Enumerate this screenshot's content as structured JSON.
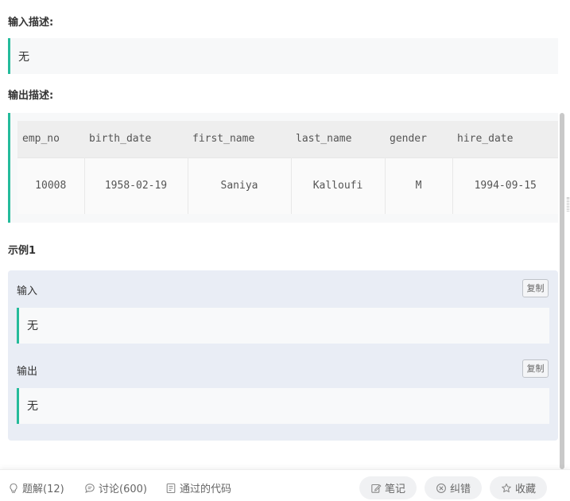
{
  "input_desc": {
    "label": "输入描述:",
    "value": "无"
  },
  "output_desc": {
    "label": "输出描述:",
    "table": {
      "headers": [
        "emp_no",
        "birth_date",
        "first_name",
        "last_name",
        "gender",
        "hire_date"
      ],
      "rows": [
        [
          "10008",
          "1958-02-19",
          "Saniya",
          "Kalloufi",
          "M",
          "1994-09-15"
        ]
      ]
    }
  },
  "example": {
    "title": "示例1",
    "input": {
      "label": "输入",
      "copy": "复制",
      "value": "无"
    },
    "output": {
      "label": "输出",
      "copy": "复制",
      "value": "无"
    }
  },
  "bottom": {
    "solutions": "题解(12)",
    "discuss": "讨论(600)",
    "passed_code": "通过的代码",
    "note": "笔记",
    "report": "纠错",
    "favorite": "收藏"
  },
  "colors": {
    "accent": "#25bb9b"
  }
}
